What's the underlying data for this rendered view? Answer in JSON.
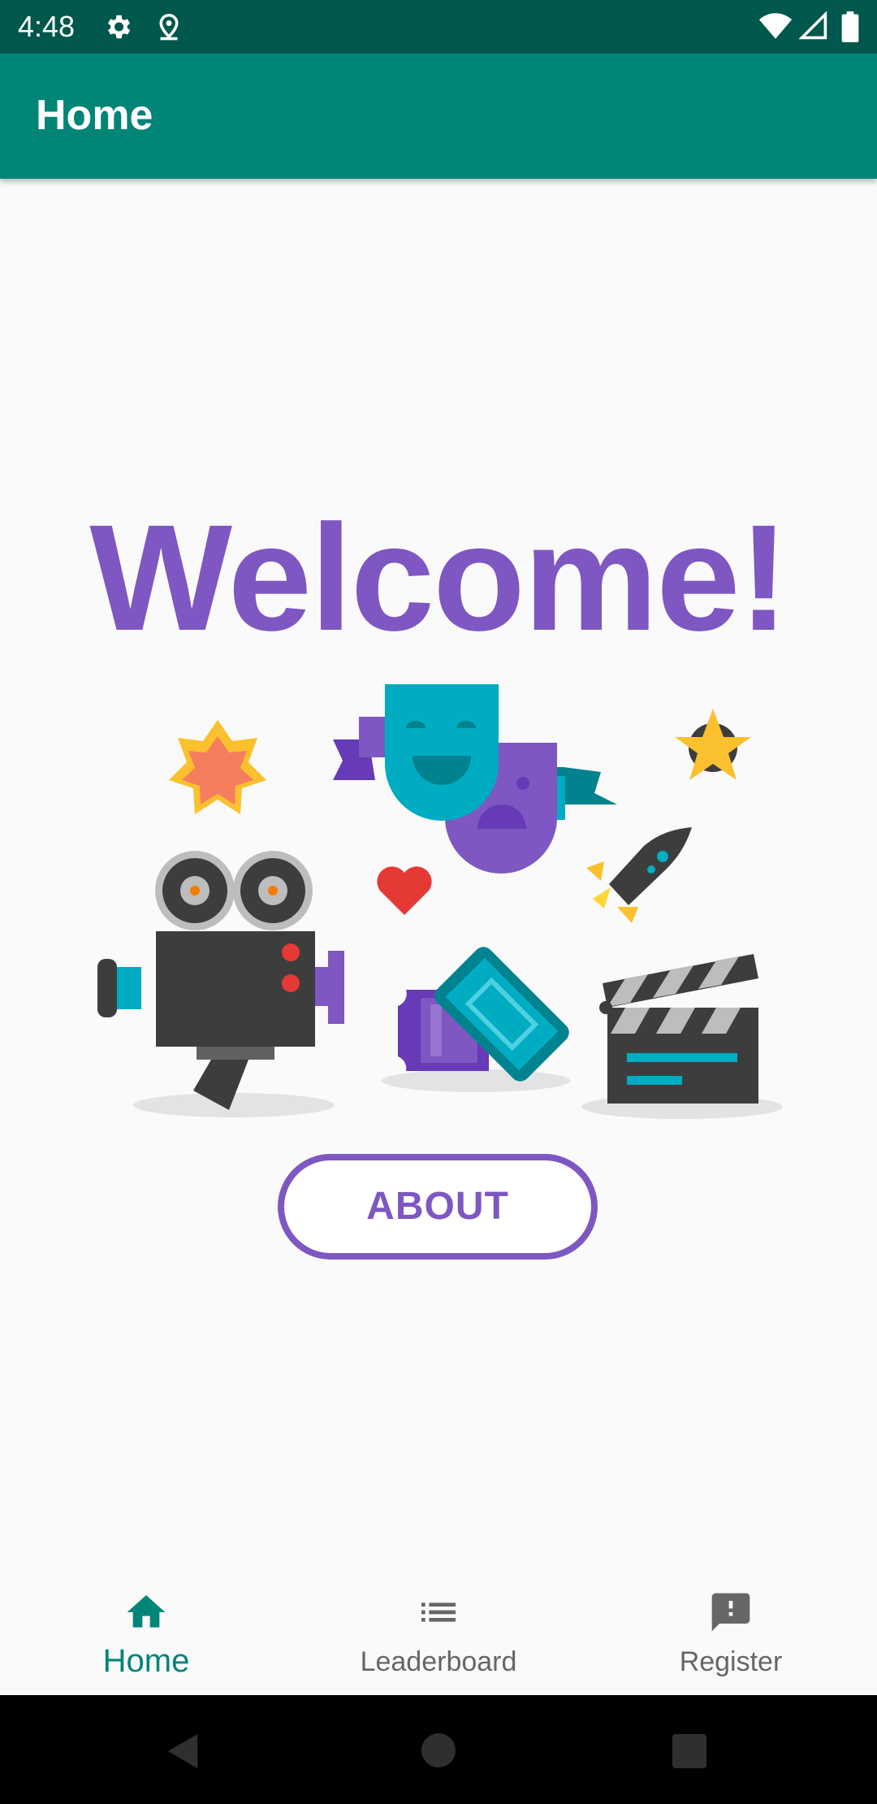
{
  "status_bar": {
    "time": "4:48",
    "left_icons": [
      "gear-icon",
      "location-icon"
    ],
    "right_icons": [
      "wifi-icon",
      "signal-icon",
      "battery-icon"
    ]
  },
  "app_bar": {
    "title": "Home"
  },
  "main": {
    "heading": "Welcome!",
    "about_button_label": "ABOUT"
  },
  "bottom_nav": {
    "items": [
      {
        "label": "Home",
        "icon": "home-icon",
        "active": true
      },
      {
        "label": "Leaderboard",
        "icon": "list-icon",
        "active": false
      },
      {
        "label": "Register",
        "icon": "feedback-icon",
        "active": false
      }
    ]
  },
  "colors": {
    "status_bar": "#00574b",
    "app_bar": "#008577",
    "accent": "#7e57c2",
    "nav_active": "#008577",
    "nav_inactive": "#666666"
  }
}
